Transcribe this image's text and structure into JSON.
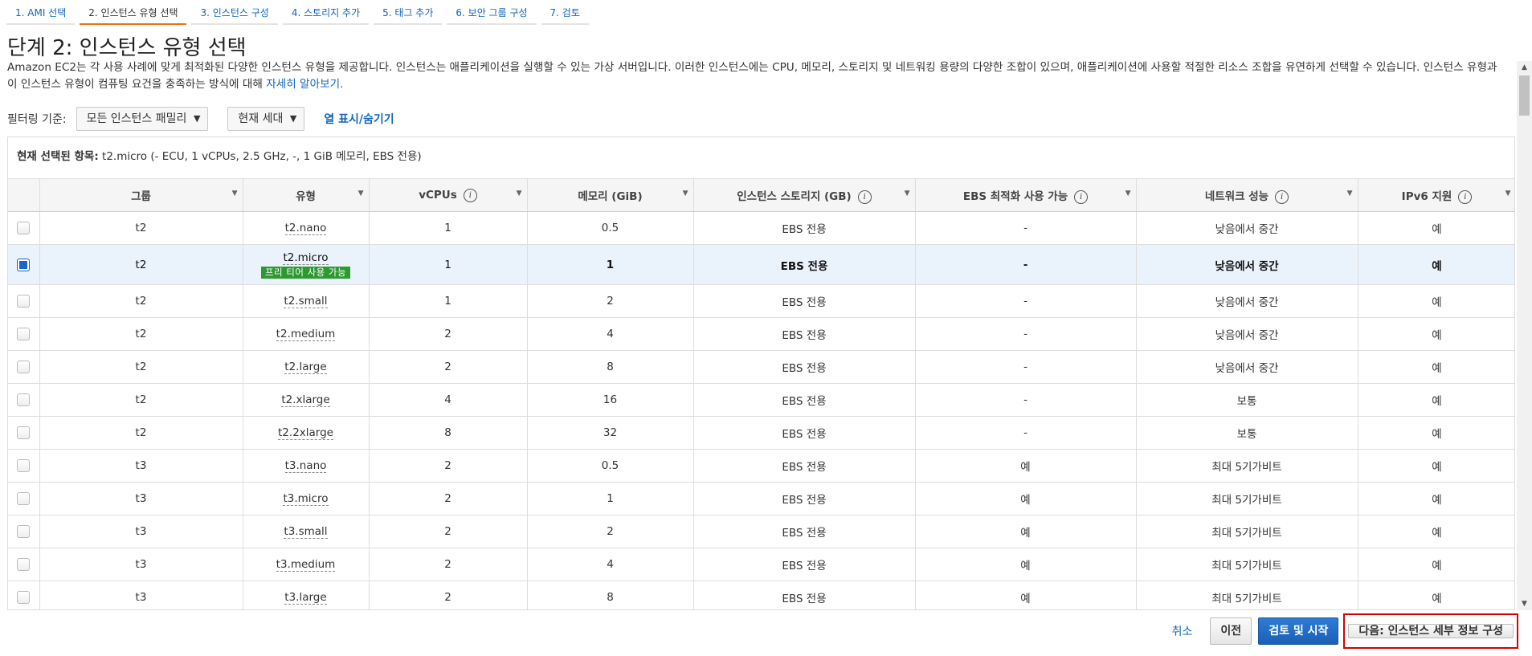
{
  "wizard_tabs": [
    {
      "label": "1. AMI 선택"
    },
    {
      "label": "2. 인스턴스 유형 선택"
    },
    {
      "label": "3. 인스턴스 구성"
    },
    {
      "label": "4. 스토리지 추가"
    },
    {
      "label": "5. 태그 추가"
    },
    {
      "label": "6. 보안 그룹 구성"
    },
    {
      "label": "7. 검토"
    }
  ],
  "title": "단계 2: 인스턴스 유형 선택",
  "description": "Amazon EC2는 각 사용 사례에 맞게 최적화된 다양한 인스턴스 유형을 제공합니다. 인스턴스는 애플리케이션을 실행할 수 있는 가상 서버입니다. 이러한 인스턴스에는 CPU, 메모리, 스토리지 및 네트워킹 용량의 다양한 조합이 있으며, 애플리케이션에 사용할 적절한 리소스 조합을 유연하게 선택할 수 있습니다. 인스턴스 유형과 이 인스턴스 유형이 컴퓨팅 요건을 충족하는 방식에 대해 ",
  "learn_more": "자세히 알아보기.",
  "filter": {
    "label": "필터링 기준:",
    "family": "모든 인스턴스 패밀리",
    "generation": "현재 세대",
    "toggle_columns": "열 표시/숨기기"
  },
  "selected": {
    "label": "현재 선택된 항목:",
    "value": " t2.micro (- ECU, 1 vCPUs, 2.5 GHz, -, 1 GiB 메모리, EBS 전용)"
  },
  "columns": [
    "그룹",
    "유형",
    "vCPUs",
    "메모리 (GiB)",
    "인스턴스 스토리지 (GB)",
    "EBS 최적화 사용 가능",
    "네트워크 성능",
    "IPv6 지원"
  ],
  "info_glyph": "i",
  "free_tier_badge": "프리 티어 사용 가능",
  "rows": [
    {
      "group": "t2",
      "type": "t2.nano",
      "vcpus": "1",
      "memory": "0.5",
      "storage": "EBS 전용",
      "ebs_opt": "-",
      "network": "낮음에서 중간",
      "ipv6": "예"
    },
    {
      "group": "t2",
      "type": "t2.micro",
      "vcpus": "1",
      "memory": "1",
      "storage": "EBS 전용",
      "ebs_opt": "-",
      "network": "낮음에서 중간",
      "ipv6": "예"
    },
    {
      "group": "t2",
      "type": "t2.small",
      "vcpus": "1",
      "memory": "2",
      "storage": "EBS 전용",
      "ebs_opt": "-",
      "network": "낮음에서 중간",
      "ipv6": "예"
    },
    {
      "group": "t2",
      "type": "t2.medium",
      "vcpus": "2",
      "memory": "4",
      "storage": "EBS 전용",
      "ebs_opt": "-",
      "network": "낮음에서 중간",
      "ipv6": "예"
    },
    {
      "group": "t2",
      "type": "t2.large",
      "vcpus": "2",
      "memory": "8",
      "storage": "EBS 전용",
      "ebs_opt": "-",
      "network": "낮음에서 중간",
      "ipv6": "예"
    },
    {
      "group": "t2",
      "type": "t2.xlarge",
      "vcpus": "4",
      "memory": "16",
      "storage": "EBS 전용",
      "ebs_opt": "-",
      "network": "보통",
      "ipv6": "예"
    },
    {
      "group": "t2",
      "type": "t2.2xlarge",
      "vcpus": "8",
      "memory": "32",
      "storage": "EBS 전용",
      "ebs_opt": "-",
      "network": "보통",
      "ipv6": "예"
    },
    {
      "group": "t3",
      "type": "t3.nano",
      "vcpus": "2",
      "memory": "0.5",
      "storage": "EBS 전용",
      "ebs_opt": "예",
      "network": "최대 5기가비트",
      "ipv6": "예"
    },
    {
      "group": "t3",
      "type": "t3.micro",
      "vcpus": "2",
      "memory": "1",
      "storage": "EBS 전용",
      "ebs_opt": "예",
      "network": "최대 5기가비트",
      "ipv6": "예"
    },
    {
      "group": "t3",
      "type": "t3.small",
      "vcpus": "2",
      "memory": "2",
      "storage": "EBS 전용",
      "ebs_opt": "예",
      "network": "최대 5기가비트",
      "ipv6": "예"
    },
    {
      "group": "t3",
      "type": "t3.medium",
      "vcpus": "2",
      "memory": "4",
      "storage": "EBS 전용",
      "ebs_opt": "예",
      "network": "최대 5기가비트",
      "ipv6": "예"
    },
    {
      "group": "t3",
      "type": "t3.large",
      "vcpus": "2",
      "memory": "8",
      "storage": "EBS 전용",
      "ebs_opt": "예",
      "network": "최대 5기가비트",
      "ipv6": "예"
    }
  ],
  "footer": {
    "cancel": "취소",
    "previous": "이전",
    "review_launch": "검토 및 시작",
    "next": "다음: 인스턴스 세부 정보 구성"
  },
  "colors": {
    "accent": "#1166bb",
    "primary_button": "#1a66c9",
    "active_tab": "#ec7211",
    "free_tier": "#2c9a31",
    "highlight": "#d40000"
  }
}
